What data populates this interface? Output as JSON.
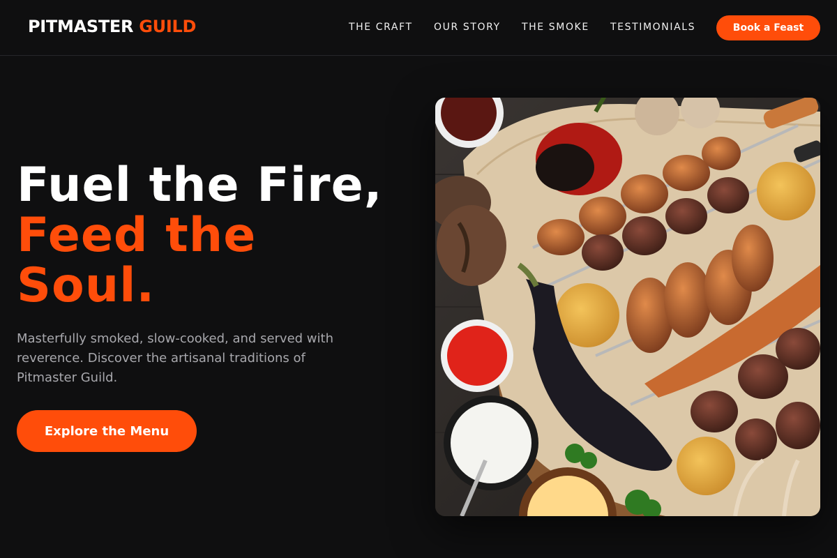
{
  "brand": {
    "name_part1": "PITMASTER",
    "name_part2": "GUILD",
    "accent_color": "#ff4d0a"
  },
  "nav": {
    "links": [
      "THE CRAFT",
      "OUR STORY",
      "THE SMOKE",
      "TESTIMONIALS"
    ],
    "cta_label": "Book a Feast"
  },
  "hero": {
    "headline_line1": "Fuel the Fire,",
    "headline_line2": "Feed the",
    "headline_line3": "Soul.",
    "subtext": "Masterfully smoked, slow-cooked, and served with reverence. Discover the artisanal traditions of Pitmaster Guild.",
    "cta_label": "Explore the Menu",
    "image_alt": "barbecue-platter-photo"
  }
}
